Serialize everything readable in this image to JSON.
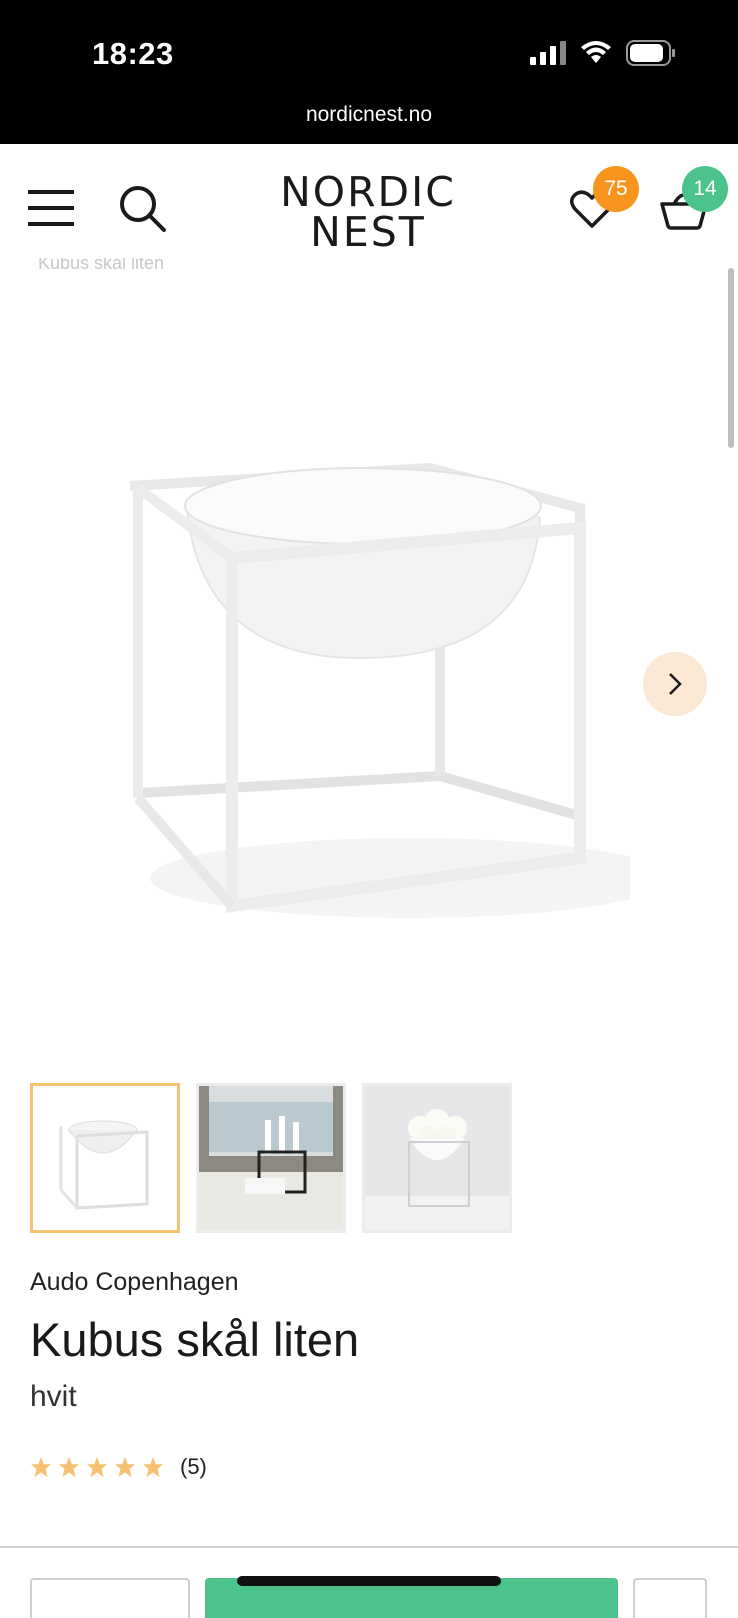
{
  "status": {
    "time": "18:23"
  },
  "browser": {
    "url": "nordicnest.no"
  },
  "header": {
    "logo_line1": "NORDIC",
    "logo_line2": "NEST",
    "wishlist_count": "75",
    "cart_count": "14",
    "icons": [
      "menu-icon",
      "search-icon",
      "heart-icon",
      "basket-icon"
    ]
  },
  "breadcrumb": "Kubus skål liten",
  "gallery": {
    "thumbnails": [
      "bowl-white-cube",
      "candle-holder-interior",
      "bowl-with-roses"
    ],
    "active_index": 0
  },
  "product": {
    "brand": "Audo Copenhagen",
    "name": "Kubus skål liten",
    "variant": "hvit",
    "rating_stars": 5,
    "review_count": "(5)"
  },
  "colors": {
    "accent_orange": "#f7941d",
    "accent_green": "#4cc38a",
    "star": "#f6c272"
  }
}
